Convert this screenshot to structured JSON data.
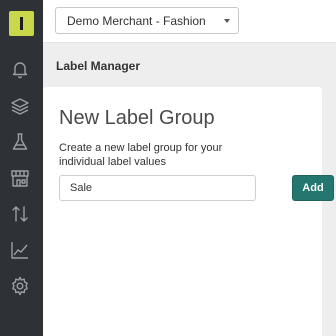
{
  "topbar": {
    "merchant_selected": "Demo Merchant - Fashion"
  },
  "page": {
    "title": "Label Manager"
  },
  "card": {
    "title": "New Label Group",
    "description": "Create a new label group for your individual label values",
    "input_value": "Sale",
    "add_label": "Add"
  },
  "sidebar": {
    "icons": [
      "bell-icon",
      "layers-icon",
      "flask-icon",
      "storefront-icon",
      "sort-arrows-icon",
      "chart-icon",
      "gear-icon"
    ]
  },
  "colors": {
    "sidebar_bg": "#2e3135",
    "logo_accent": "#c8d84a",
    "primary_button": "#23776f",
    "page_bg": "#eeeeee"
  }
}
